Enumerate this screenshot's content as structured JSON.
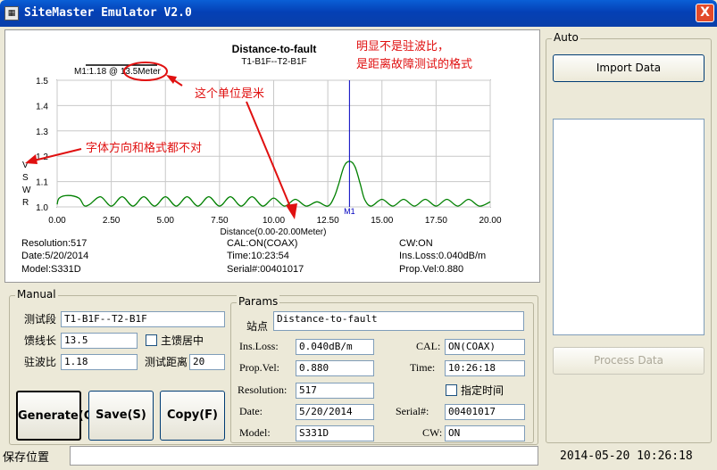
{
  "window": {
    "title": "SiteMaster Emulator V2.0",
    "close": "X"
  },
  "chart_data": {
    "type": "line",
    "title": "Distance-to-fault",
    "subtitle": "T1-B1F--T2-B1F",
    "marker_readout": "M1:1.18 @ 13.5Meter",
    "marker_label": "M1",
    "marker_x": 13.5,
    "xlabel": "Distance(0.00-20.00Meter)",
    "ylabel_chars": [
      "V",
      "S",
      "W",
      "R"
    ],
    "xlim": [
      0,
      20
    ],
    "ylim": [
      1.0,
      1.5
    ],
    "x_ticks": [
      "0.00",
      "2.50",
      "5.00",
      "7.50",
      "10.00",
      "12.50",
      "15.00",
      "17.50",
      "20.00"
    ],
    "y_ticks": [
      "1.0",
      "1.1",
      "1.2",
      "1.3",
      "1.4",
      "1.5"
    ],
    "grid": true,
    "series": [
      {
        "color": "#008000",
        "x": [
          0,
          0.1,
          0.5,
          1.0,
          1.25,
          1.5,
          2.0,
          2.5,
          3.0,
          3.5,
          4.0,
          4.5,
          5.0,
          5.5,
          6.0,
          6.5,
          7.0,
          7.5,
          8.0,
          8.5,
          9.0,
          9.5,
          10.0,
          10.5,
          11.0,
          11.5,
          12.0,
          12.5,
          12.8,
          13.0,
          13.25,
          13.5,
          13.75,
          14.0,
          14.2,
          14.5,
          15.0,
          15.5,
          16.0,
          16.5,
          17.0,
          17.5,
          18.0,
          18.5,
          19.0,
          19.5,
          20.0
        ],
        "y": [
          1.01,
          1.035,
          1.045,
          1.035,
          1.005,
          1.01,
          1.04,
          1.003,
          1.04,
          1.003,
          1.04,
          1.003,
          1.04,
          1.003,
          1.04,
          1.003,
          1.04,
          1.003,
          1.04,
          1.003,
          1.04,
          1.003,
          1.035,
          1.003,
          1.03,
          1.003,
          1.02,
          1.003,
          1.04,
          1.09,
          1.16,
          1.18,
          1.16,
          1.09,
          1.03,
          1.003,
          1.03,
          1.003,
          1.03,
          1.003,
          1.03,
          1.003,
          1.03,
          1.003,
          1.03,
          1.003,
          1.02
        ]
      }
    ]
  },
  "chart_info": {
    "resolution": "Resolution:517",
    "date": "Date:5/20/2014",
    "model": "Model:S331D",
    "cal": "CAL:ON(COAX)",
    "time": "Time:10:23:54",
    "serial": "Serial#:00401017",
    "cw": "CW:ON",
    "ins_loss": "Ins.Loss:0.040dB/m",
    "prop_vel": "Prop.Vel:0.880"
  },
  "annotations": {
    "top_right_line1": "明显不是驻波比，",
    "top_right_line2": "是距离故障测试的格式",
    "unit_note": "这个单位是米",
    "font_note": "字体方向和格式都不对"
  },
  "manual": {
    "group_label": "Manual",
    "segment_label": "测试段",
    "segment_value": "T1-B1F--T2-B1F",
    "feeder_label": "馈线长",
    "feeder_value": "13.5",
    "main_feeder_label": "主馈居中",
    "vswr_label": "驻波比",
    "vswr_value": "1.18",
    "distance_label": "测试距离",
    "distance_value": "20",
    "generate": "Generate(C)",
    "save": "Save(S)",
    "copy": "Copy(F)"
  },
  "params": {
    "group_label": "Params",
    "site_label": "站点",
    "site_value": "Distance-to-fault",
    "ins_loss_label": "Ins.Loss:",
    "ins_loss_value": "0.040dB/m",
    "cal_label": "CAL:",
    "cal_value": "ON(COAX)",
    "prop_vel_label": "Prop.Vel:",
    "prop_vel_value": "0.880",
    "time_label": "Time:",
    "time_value": "10:26:18",
    "resolution_label": "Resolution:",
    "resolution_value": "517",
    "specify_time_label": "指定时间",
    "date_label": "Date:",
    "date_value": "5/20/2014",
    "serial_label": "Serial#:",
    "serial_value": "00401017",
    "model_label": "Model:",
    "model_value": "S331D",
    "cw_label": "CW:",
    "cw_value": "ON"
  },
  "auto": {
    "group_label": "Auto",
    "import_button": "Import Data",
    "process_button": "Process Data"
  },
  "status": {
    "save_location_label": "保存位置",
    "datetime": "2014-05-20 10:26:18"
  }
}
